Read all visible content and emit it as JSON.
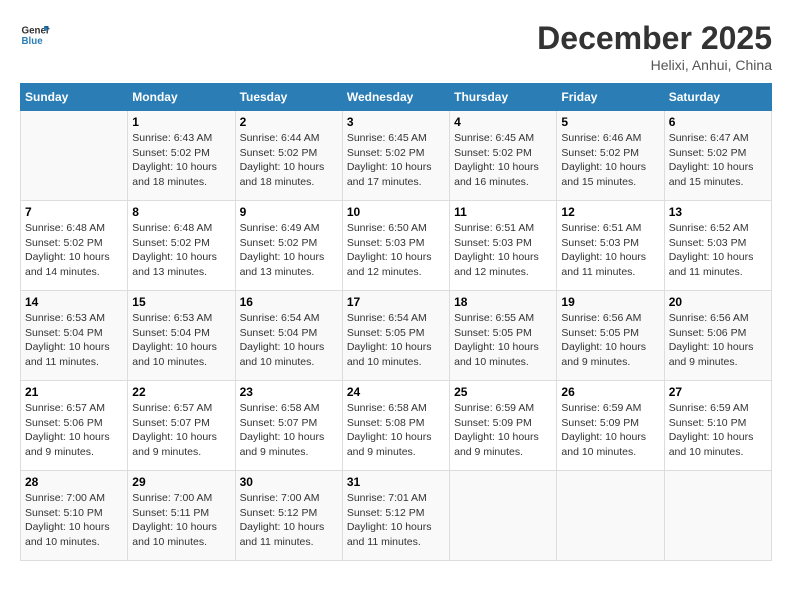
{
  "header": {
    "logo_line1": "General",
    "logo_line2": "Blue",
    "month": "December 2025",
    "location": "Helixi, Anhui, China"
  },
  "weekdays": [
    "Sunday",
    "Monday",
    "Tuesday",
    "Wednesday",
    "Thursday",
    "Friday",
    "Saturday"
  ],
  "weeks": [
    [
      {
        "day": "",
        "info": ""
      },
      {
        "day": "1",
        "info": "Sunrise: 6:43 AM\nSunset: 5:02 PM\nDaylight: 10 hours\nand 18 minutes."
      },
      {
        "day": "2",
        "info": "Sunrise: 6:44 AM\nSunset: 5:02 PM\nDaylight: 10 hours\nand 18 minutes."
      },
      {
        "day": "3",
        "info": "Sunrise: 6:45 AM\nSunset: 5:02 PM\nDaylight: 10 hours\nand 17 minutes."
      },
      {
        "day": "4",
        "info": "Sunrise: 6:45 AM\nSunset: 5:02 PM\nDaylight: 10 hours\nand 16 minutes."
      },
      {
        "day": "5",
        "info": "Sunrise: 6:46 AM\nSunset: 5:02 PM\nDaylight: 10 hours\nand 15 minutes."
      },
      {
        "day": "6",
        "info": "Sunrise: 6:47 AM\nSunset: 5:02 PM\nDaylight: 10 hours\nand 15 minutes."
      }
    ],
    [
      {
        "day": "7",
        "info": "Sunrise: 6:48 AM\nSunset: 5:02 PM\nDaylight: 10 hours\nand 14 minutes."
      },
      {
        "day": "8",
        "info": "Sunrise: 6:48 AM\nSunset: 5:02 PM\nDaylight: 10 hours\nand 13 minutes."
      },
      {
        "day": "9",
        "info": "Sunrise: 6:49 AM\nSunset: 5:02 PM\nDaylight: 10 hours\nand 13 minutes."
      },
      {
        "day": "10",
        "info": "Sunrise: 6:50 AM\nSunset: 5:03 PM\nDaylight: 10 hours\nand 12 minutes."
      },
      {
        "day": "11",
        "info": "Sunrise: 6:51 AM\nSunset: 5:03 PM\nDaylight: 10 hours\nand 12 minutes."
      },
      {
        "day": "12",
        "info": "Sunrise: 6:51 AM\nSunset: 5:03 PM\nDaylight: 10 hours\nand 11 minutes."
      },
      {
        "day": "13",
        "info": "Sunrise: 6:52 AM\nSunset: 5:03 PM\nDaylight: 10 hours\nand 11 minutes."
      }
    ],
    [
      {
        "day": "14",
        "info": "Sunrise: 6:53 AM\nSunset: 5:04 PM\nDaylight: 10 hours\nand 11 minutes."
      },
      {
        "day": "15",
        "info": "Sunrise: 6:53 AM\nSunset: 5:04 PM\nDaylight: 10 hours\nand 10 minutes."
      },
      {
        "day": "16",
        "info": "Sunrise: 6:54 AM\nSunset: 5:04 PM\nDaylight: 10 hours\nand 10 minutes."
      },
      {
        "day": "17",
        "info": "Sunrise: 6:54 AM\nSunset: 5:05 PM\nDaylight: 10 hours\nand 10 minutes."
      },
      {
        "day": "18",
        "info": "Sunrise: 6:55 AM\nSunset: 5:05 PM\nDaylight: 10 hours\nand 10 minutes."
      },
      {
        "day": "19",
        "info": "Sunrise: 6:56 AM\nSunset: 5:05 PM\nDaylight: 10 hours\nand 9 minutes."
      },
      {
        "day": "20",
        "info": "Sunrise: 6:56 AM\nSunset: 5:06 PM\nDaylight: 10 hours\nand 9 minutes."
      }
    ],
    [
      {
        "day": "21",
        "info": "Sunrise: 6:57 AM\nSunset: 5:06 PM\nDaylight: 10 hours\nand 9 minutes."
      },
      {
        "day": "22",
        "info": "Sunrise: 6:57 AM\nSunset: 5:07 PM\nDaylight: 10 hours\nand 9 minutes."
      },
      {
        "day": "23",
        "info": "Sunrise: 6:58 AM\nSunset: 5:07 PM\nDaylight: 10 hours\nand 9 minutes."
      },
      {
        "day": "24",
        "info": "Sunrise: 6:58 AM\nSunset: 5:08 PM\nDaylight: 10 hours\nand 9 minutes."
      },
      {
        "day": "25",
        "info": "Sunrise: 6:59 AM\nSunset: 5:09 PM\nDaylight: 10 hours\nand 9 minutes."
      },
      {
        "day": "26",
        "info": "Sunrise: 6:59 AM\nSunset: 5:09 PM\nDaylight: 10 hours\nand 10 minutes."
      },
      {
        "day": "27",
        "info": "Sunrise: 6:59 AM\nSunset: 5:10 PM\nDaylight: 10 hours\nand 10 minutes."
      }
    ],
    [
      {
        "day": "28",
        "info": "Sunrise: 7:00 AM\nSunset: 5:10 PM\nDaylight: 10 hours\nand 10 minutes."
      },
      {
        "day": "29",
        "info": "Sunrise: 7:00 AM\nSunset: 5:11 PM\nDaylight: 10 hours\nand 10 minutes."
      },
      {
        "day": "30",
        "info": "Sunrise: 7:00 AM\nSunset: 5:12 PM\nDaylight: 10 hours\nand 11 minutes."
      },
      {
        "day": "31",
        "info": "Sunrise: 7:01 AM\nSunset: 5:12 PM\nDaylight: 10 hours\nand 11 minutes."
      },
      {
        "day": "",
        "info": ""
      },
      {
        "day": "",
        "info": ""
      },
      {
        "day": "",
        "info": ""
      }
    ]
  ]
}
